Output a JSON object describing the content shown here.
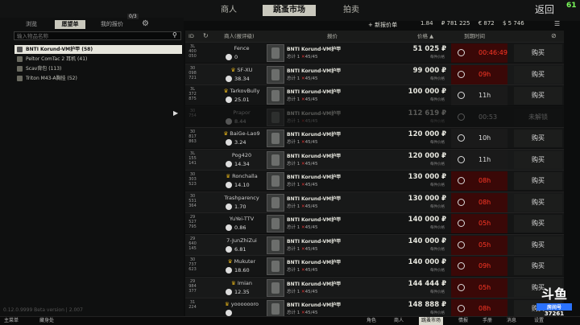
{
  "topbar": {
    "tabs": [
      "商人",
      "跳蚤市场",
      "拍卖"
    ],
    "back": "返回",
    "fps": "61"
  },
  "left": {
    "tabs": {
      "browse": "浏览",
      "wishlist": "愿望单",
      "my_offers": "我的报价",
      "offers_count": "0/3"
    },
    "search_placeholder": "输入物品名称",
    "wishlist_items": [
      "BNTI Korund-VM护甲 (58)",
      "Peltor ComTac 2 耳机 (41)",
      "Scav背包 (113)",
      "Triton M43-A胸挂 (52)"
    ],
    "version": "0.12.0.9999 Beta version | 2.007"
  },
  "toolbar": {
    "new_offer": "+ 新报价单",
    "rating": "1.84",
    "roubles": "₽ 781 225",
    "euros": "€ 872",
    "dollars": "$ 5 746"
  },
  "table": {
    "headers": {
      "id": "ID",
      "seller": "商人(报评级)",
      "item": "报价",
      "price": "价格 ▲",
      "expire": "到期时间"
    },
    "rows": [
      {
        "id": [
          "3L",
          "400",
          "050"
        ],
        "seller": "Fence",
        "crown": false,
        "rating": "0",
        "item": "BNTI Korund-VM护甲",
        "reqs": [
          "总计 1",
          "45/45"
        ],
        "price": "51 025 ₽",
        "unit": "每件价格",
        "time": "00:46:49",
        "red": true,
        "buy": "购买",
        "dim": false
      },
      {
        "id": [
          "30",
          "098",
          "721"
        ],
        "seller": "SF-XU",
        "crown": true,
        "rating": "38.34",
        "item": "BNTI Korund-VM护甲",
        "reqs": [
          "总计 1",
          "45/45"
        ],
        "price": "99 000 ₽",
        "unit": "每件价格",
        "time": "09h",
        "red": true,
        "buy": "购买",
        "dim": false
      },
      {
        "id": [
          "3L",
          "372",
          "875"
        ],
        "seller": "TarkovBully",
        "crown": true,
        "rating": "25.01",
        "item": "BNTI Korund-VM护甲",
        "reqs": [
          "总计 1",
          "45/45"
        ],
        "price": "100 000 ₽",
        "unit": "每件价格",
        "time": "11h",
        "red": false,
        "buy": "购买",
        "dim": false
      },
      {
        "id": [
          "30",
          "754",
          ""
        ],
        "seller": "Prapor",
        "crown": false,
        "rating": "8.44",
        "item": "BNTI Korund-VM护甲",
        "reqs": [
          "总计 1",
          "45/45"
        ],
        "price": "112 619 ₽",
        "unit": "每件价格",
        "time": "00:53",
        "red": false,
        "buy": "未解锁",
        "dim": true
      },
      {
        "id": [
          "30",
          "817",
          "863"
        ],
        "seller": "BaiGe-Lao9",
        "crown": true,
        "rating": "3.24",
        "item": "BNTI Korund-VM护甲",
        "reqs": [
          "总计 1",
          "45/45"
        ],
        "price": "120 000 ₽",
        "unit": "每件价格",
        "time": "10h",
        "red": false,
        "buy": "购买",
        "dim": false
      },
      {
        "id": [
          "3L",
          "155",
          "141"
        ],
        "seller": "Pog420",
        "crown": false,
        "rating": "14.34",
        "item": "BNTI Korund-VM护甲",
        "reqs": [
          "总计 1",
          "45/45"
        ],
        "price": "120 000 ₽",
        "unit": "每件价格",
        "time": "11h",
        "red": false,
        "buy": "购买",
        "dim": false
      },
      {
        "id": [
          "30",
          "303",
          "523"
        ],
        "seller": "Ronchalla",
        "crown": true,
        "rating": "14.10",
        "item": "BNTI Korund-VM护甲",
        "reqs": [
          "总计 1",
          "45/45"
        ],
        "price": "130 000 ₽",
        "unit": "每件价格",
        "time": "08h",
        "red": true,
        "buy": "购买",
        "dim": false
      },
      {
        "id": [
          "30",
          "531",
          "364"
        ],
        "seller": "Trashparency",
        "crown": false,
        "rating": "1.70",
        "item": "BNTI Korund-VM护甲",
        "reqs": [
          "总计 1",
          "45/45"
        ],
        "price": "130 000 ₽",
        "unit": "每件价格",
        "time": "08h",
        "red": true,
        "buy": "购买",
        "dim": false
      },
      {
        "id": [
          "29",
          "527",
          "795"
        ],
        "seller": "YuYei-TTV",
        "crown": false,
        "rating": "0.86",
        "item": "BNTI Korund-VM护甲",
        "reqs": [
          "总计 1",
          "45/45"
        ],
        "price": "140 000 ₽",
        "unit": "每件价格",
        "time": "05h",
        "red": true,
        "buy": "购买",
        "dim": false
      },
      {
        "id": [
          "29",
          "640",
          "145"
        ],
        "seller": "7-JunZhiZui",
        "crown": false,
        "rating": "6.81",
        "item": "BNTI Korund-VM护甲",
        "reqs": [
          "总计 1",
          "45/45"
        ],
        "price": "140 000 ₽",
        "unit": "每件价格",
        "time": "05h",
        "red": true,
        "buy": "购买",
        "dim": false
      },
      {
        "id": [
          "30",
          "737",
          "623"
        ],
        "seller": "Mukuter",
        "crown": true,
        "rating": "18.60",
        "item": "BNTI Korund-VM护甲",
        "reqs": [
          "总计 1",
          "45/45"
        ],
        "price": "140 000 ₽",
        "unit": "每件价格",
        "time": "09h",
        "red": true,
        "buy": "购买",
        "dim": false
      },
      {
        "id": [
          "29",
          "984",
          "377"
        ],
        "seller": "Imian",
        "crown": true,
        "rating": "12.35",
        "item": "BNTI Korund-VM护甲",
        "reqs": [
          "总计 1",
          "45/45"
        ],
        "price": "144 444 ₽",
        "unit": "每件价格",
        "time": "05h",
        "red": true,
        "buy": "购买",
        "dim": false
      },
      {
        "id": [
          "31",
          "224",
          ""
        ],
        "seller": "yooooooro",
        "crown": true,
        "rating": "",
        "item": "BNTI Korund-VM护甲",
        "reqs": [
          "总计 1",
          "45/45"
        ],
        "price": "148 888 ₽",
        "unit": "每件价格",
        "time": "08h",
        "red": true,
        "buy": "购买",
        "dim": false
      }
    ]
  },
  "bottombar": {
    "left": [
      "主菜单",
      "藏身处"
    ],
    "right": [
      "角色",
      "商人",
      "跳蚤市场",
      "情报",
      "手册",
      "消息",
      "设置"
    ],
    "active": "跳蚤市场"
  },
  "watermark": {
    "logo": "斗鱼",
    "sub": "房间号",
    "room": "37261"
  }
}
